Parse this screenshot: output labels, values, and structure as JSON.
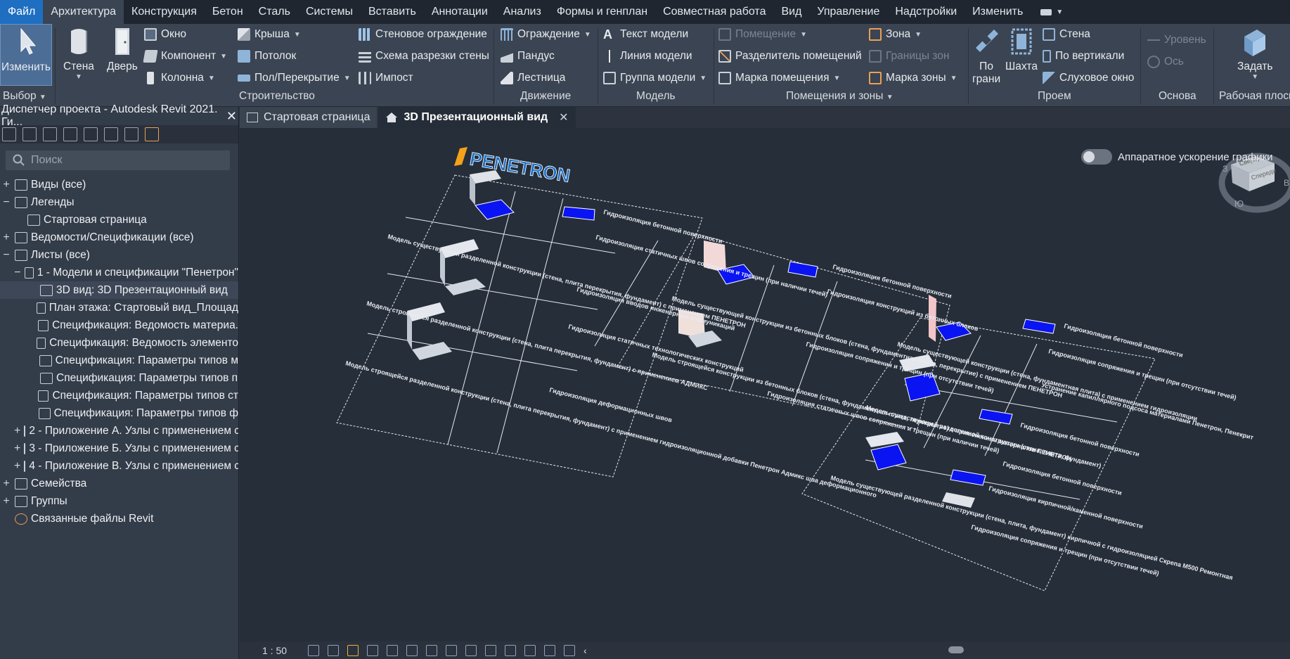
{
  "menu": [
    "Файл",
    "Архитектура",
    "Конструкция",
    "Бетон",
    "Сталь",
    "Системы",
    "Вставить",
    "Аннотации",
    "Анализ",
    "Формы и генплан",
    "Совместная работа",
    "Вид",
    "Управление",
    "Надстройки",
    "Изменить"
  ],
  "ribbon": {
    "select": {
      "modify": "Изменить",
      "panel": "Выбор"
    },
    "build": {
      "wall": "Стена",
      "door": "Дверь",
      "window": "Окно",
      "component": "Компонент",
      "column": "Колонна",
      "roof": "Крыша",
      "ceiling": "Потолок",
      "floor": "Пол/Перекрытие",
      "curtain_system": "Стеновое ограждение",
      "curtain_grid": "Схема разрезки стены",
      "mullion": "Импост",
      "panel": "Строительство"
    },
    "circulation": {
      "railing": "Ограждение",
      "ramp": "Пандус",
      "stair": "Лестница",
      "panel": "Движение"
    },
    "model": {
      "model_text": "Текст модели",
      "model_line": "Линия  модели",
      "model_group": "Группа модели",
      "panel": "Модель"
    },
    "room": {
      "room": "Помещение",
      "room_separator": "Разделитель помещений",
      "room_tag": "Марка  помещения",
      "area": "Зона",
      "area_boundary": "Границы  зон",
      "area_tag": "Марка  зоны",
      "panel": "Помещения и зоны"
    },
    "opening": {
      "by_face_1": "По",
      "by_face_2": "грани",
      "shaft": "Шахта",
      "wall": "Стена",
      "vertical": "По вертикали",
      "dormer": "Слуховое окно",
      "panel": "Проем"
    },
    "datum": {
      "level": "Уровень",
      "grid": "Ось",
      "panel": "Основа"
    },
    "workplane": {
      "set": "Задать",
      "panel": "Рабочая плоск"
    }
  },
  "browser": {
    "title": "Диспетчер проекта - Autodesk Revit 2021. Ги...",
    "search_placeholder": "Поиск",
    "tree": [
      {
        "label": "Виды (все)",
        "toggle": "+",
        "indent": 0
      },
      {
        "label": "Легенды",
        "toggle": "−",
        "indent": 0
      },
      {
        "label": "Стартовая страница",
        "toggle": "",
        "indent": 1
      },
      {
        "label": "Ведомости/Спецификации (все)",
        "toggle": "+",
        "indent": 0
      },
      {
        "label": "Листы (все)",
        "toggle": "−",
        "indent": 0
      },
      {
        "label": "1 - Модели и спецификации \"Пенетрон\"",
        "toggle": "−",
        "indent": 1
      },
      {
        "label": "3D вид: 3D Презентационный вид",
        "toggle": "",
        "indent": 2
      },
      {
        "label": "План этажа: Стартовый вид_Площад",
        "toggle": "",
        "indent": 2
      },
      {
        "label": "Спецификация: Ведомость материа.",
        "toggle": "",
        "indent": 2
      },
      {
        "label": "Спецификация: Ведомость элементо",
        "toggle": "",
        "indent": 2
      },
      {
        "label": "Спецификация: Параметры типов м",
        "toggle": "",
        "indent": 2
      },
      {
        "label": "Спецификация: Параметры типов п",
        "toggle": "",
        "indent": 2
      },
      {
        "label": "Спецификация: Параметры типов ст",
        "toggle": "",
        "indent": 2
      },
      {
        "label": "Спецификация: Параметры типов ф",
        "toggle": "",
        "indent": 2
      },
      {
        "label": "2 - Приложение А. Узлы с применением си",
        "toggle": "+",
        "indent": 1
      },
      {
        "label": "3 - Приложение Б. Узлы с применением си",
        "toggle": "+",
        "indent": 1
      },
      {
        "label": "4 - Приложение В. Узлы с применением си",
        "toggle": "+",
        "indent": 1
      },
      {
        "label": "Семейства",
        "toggle": "+",
        "indent": 0
      },
      {
        "label": "Группы",
        "toggle": "+",
        "indent": 0
      },
      {
        "label": "Связанные файлы Revit",
        "toggle": "",
        "indent": 0
      }
    ]
  },
  "tabs": [
    {
      "label": "Стартовая страница"
    },
    {
      "label": "3D Презентационный вид"
    }
  ],
  "view": {
    "hw_accel": "Аппаратное ускорение графики",
    "logo": "PENETRON",
    "viewcube": {
      "top": "Сверху",
      "front": "Спереди",
      "south": "Ю",
      "west": "З",
      "east": "В"
    },
    "texts": {
      "s1": "Модель существующей разделенной конструкции (стена, плита перекрытия, фундамент) с применением ПЕНЕТРОН",
      "s2": "Модель строящейся разделенной конструкции (стена, плита перекрытия, фундамент) с применением АДМИКС",
      "s3": "Модель строящейся разделенной конструкции (стена, плита перекрытия, фундамент) с применением гидроизоляционной добавки Пенетрон Адмикс шва деформационного",
      "m1": "Модель существующей конструкции из бетонных блоков (стена, фундаментная плита, перекрытие) с применением ПЕНЕТРОН",
      "m2": "Модель строящейся конструкции из бетонных блоков (стена, фундаментная плита, перекрытие) с применением материалов ПЕНЕТРОН",
      "r1": "Модель существующей конструкции (стена, фундаментная плита) с применением гидроизоляции",
      "r2": "Модель существующей разделенной конструкции (стена, плита, фундамент)",
      "r3": "Модель существующей разделенной конструкции (стена, плита, фундамент) кирпичной с гидроизоляцией Скрепа М500 Ремонтная",
      "d1": "Гидроизоляция бетонной поверхности",
      "d2": "Гидроизоляция сопряжения и трещин (при отсутствии течей)",
      "d3": "Гидроизоляция статичных швов сопряжения и трещин (при наличии течей)",
      "d4": "Гидроизоляция вводов инженерных коммуникаций",
      "d5": "Гидроизоляция статичных технологических конструкций",
      "d6": "Гидроизоляция деформационных швов",
      "d7": "Гидроизоляция конструкций из бетонных блоков",
      "d8": "Устранение капиллярного подсоса материалами Пенетрон, Пенекрит",
      "d9": "Гидроизоляция кирпичной/каменной поверхности"
    }
  },
  "status": {
    "scale": "1 : 50"
  },
  "colors": {
    "accent": "#1e6fc2",
    "blue_fill": "#0a14f2",
    "bg": "#262e3a"
  }
}
